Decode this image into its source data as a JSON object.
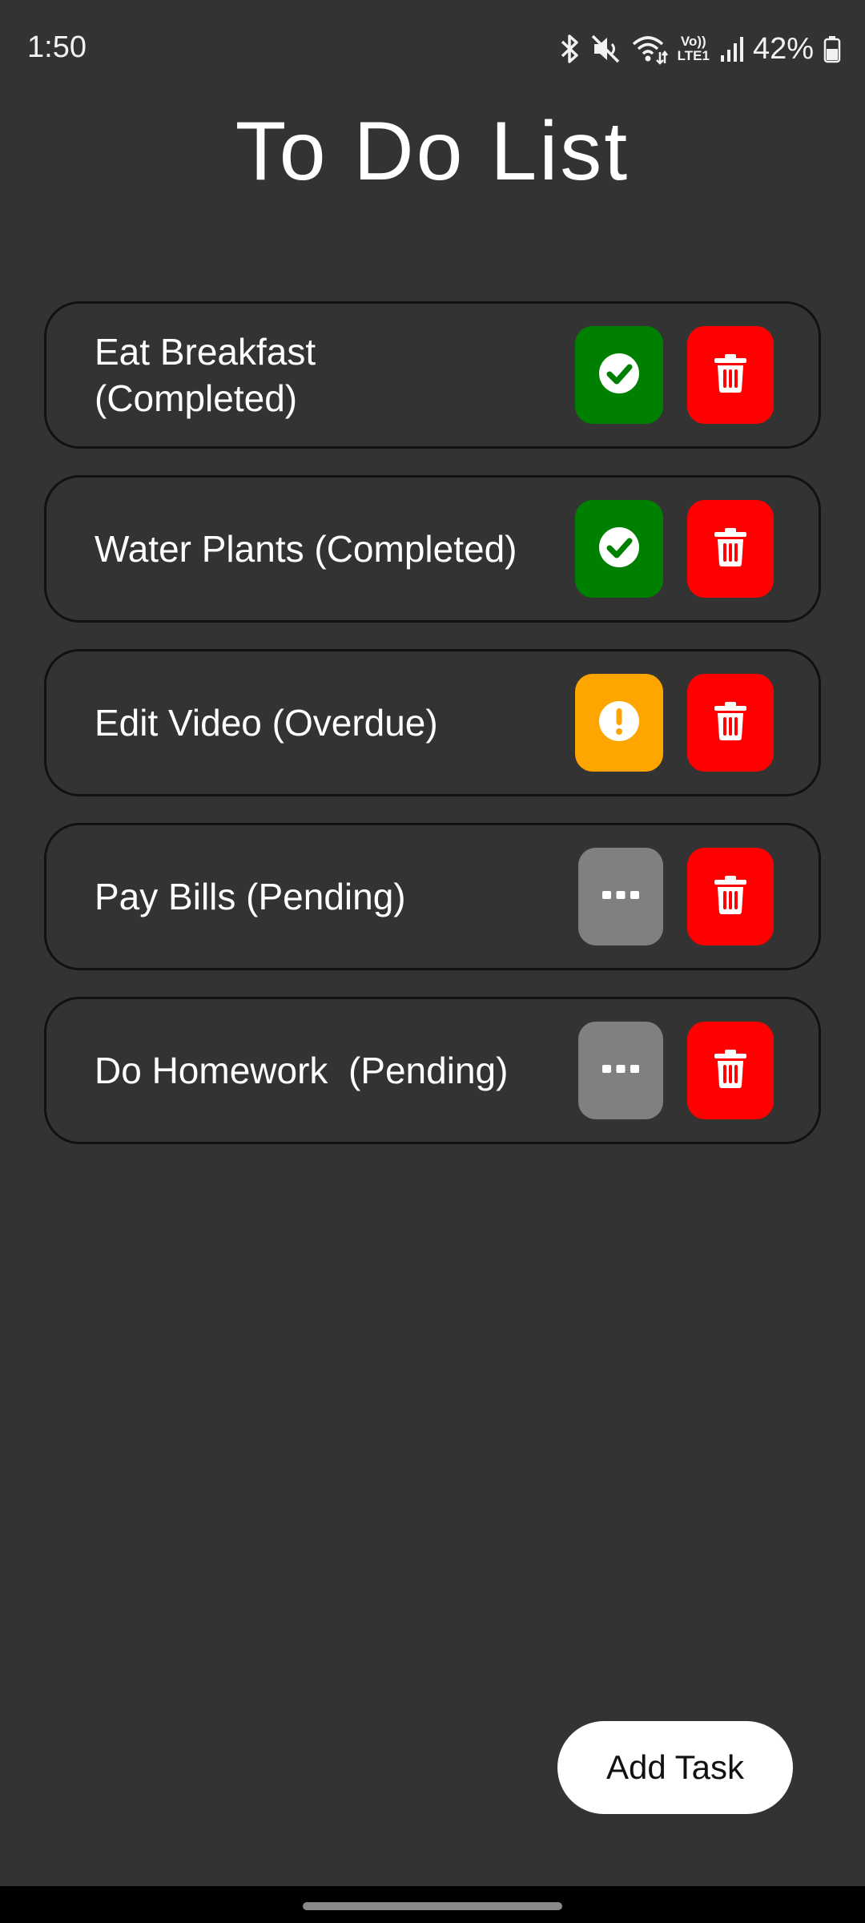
{
  "status_bar": {
    "time": "1:50",
    "battery_percent": "42%",
    "icons": [
      "bluetooth-icon",
      "mute-icon",
      "wifi-icon",
      "volte-icon",
      "signal-icon",
      "battery-icon"
    ],
    "volte_label_top": "Vo))",
    "volte_label_bottom": "LTE1"
  },
  "header": {
    "title": "To Do List"
  },
  "colors": {
    "background": "#333333",
    "completed": "#008000",
    "overdue": "#FFA500",
    "pending": "#808080",
    "delete": "#FF0000"
  },
  "tasks": [
    {
      "text": "Eat Breakfast\n(Completed)",
      "status": "completed",
      "status_icon": "check-circle-icon",
      "delete_icon": "trash-icon"
    },
    {
      "text": "Water Plants (Completed)",
      "status": "completed",
      "status_icon": "check-circle-icon",
      "delete_icon": "trash-icon"
    },
    {
      "text": "Edit Video (Overdue)",
      "status": "overdue",
      "status_icon": "exclamation-circle-icon",
      "delete_icon": "trash-icon"
    },
    {
      "text": "Pay Bills (Pending)",
      "status": "pending",
      "status_icon": "ellipsis-icon",
      "delete_icon": "trash-icon"
    },
    {
      "text": "Do Homework  (Pending)",
      "status": "pending",
      "status_icon": "ellipsis-icon",
      "delete_icon": "trash-icon"
    }
  ],
  "add_task_button": {
    "label": "Add Task"
  }
}
